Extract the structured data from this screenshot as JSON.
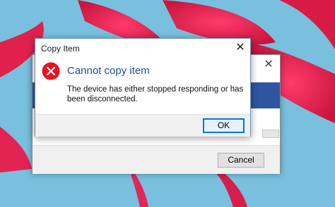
{
  "colors": {
    "headline": "#1e4e9c",
    "error_icon": "#e81123",
    "accent_border": "#0078d7",
    "back_band": "#2f55a0"
  },
  "back_window": {
    "close_icon": "close-icon",
    "cancel_label": "Cancel"
  },
  "dialog": {
    "title": "Copy Item",
    "close_icon": "close-icon",
    "icon": "error-icon",
    "headline": "Cannot copy item",
    "message": "The device has either stopped responding or has been disconnected.",
    "ok_label": "OK"
  }
}
